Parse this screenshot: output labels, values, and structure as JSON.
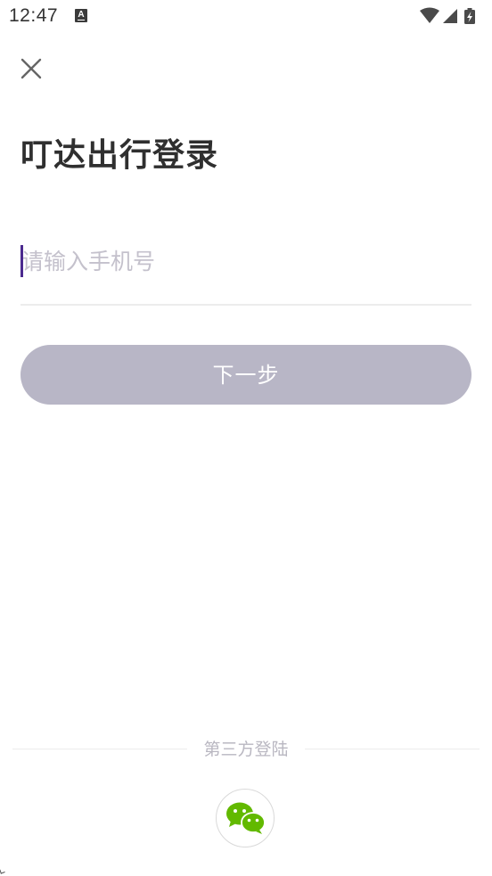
{
  "status_bar": {
    "time": "12:47",
    "notification_icon": "a-icon",
    "indicators": [
      "wifi-icon",
      "signal-icon",
      "battery-charging-icon"
    ]
  },
  "header": {
    "close_icon": "close-icon"
  },
  "login": {
    "title": "叮达出行登录",
    "phone_placeholder": "请输入手机号",
    "phone_value": "",
    "next_button_label": "下一步"
  },
  "third_party": {
    "label": "第三方登陆",
    "providers": [
      {
        "icon": "wechat-icon",
        "color": "#62B900"
      }
    ]
  },
  "colors": {
    "caret": "#4B2A8F",
    "button_disabled": "#B8B6C6",
    "placeholder": "#C4C1CC",
    "wechat_green": "#62B900"
  }
}
